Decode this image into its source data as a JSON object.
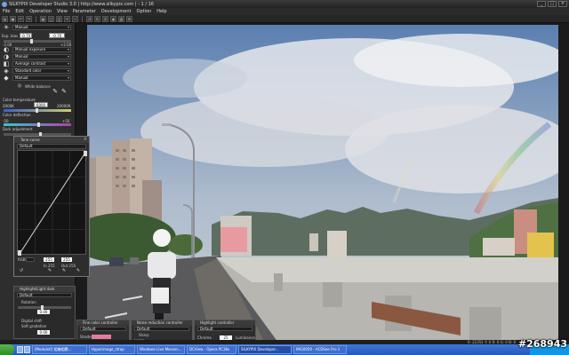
{
  "window": {
    "title": "SILKYPIX Developer Studio 3.0 | http://www.silkypix.com | - 1 / 16"
  },
  "menu": [
    "File",
    "Edit",
    "Operation",
    "View",
    "Parameter",
    "Development",
    "Option",
    "Help"
  ],
  "left_panel": {
    "exposure": {
      "label": "Exp. bias",
      "value": "-0.70",
      "value2": "-0.70"
    },
    "slider_min": "-2.00",
    "slider_max": "+2.00",
    "presets": [
      "Manual",
      "Manual exposure",
      "Manual",
      "Average contrast",
      "Standard color",
      "Manual"
    ],
    "white_balance": "White balance",
    "color_temperature": {
      "label": "Color temperature",
      "min": "2000K",
      "value": "6000",
      "max": "20000K"
    },
    "color_deflection": {
      "label": "Color deflection",
      "min": "-50",
      "max": "+50"
    },
    "dark_adjustment": "Dark adjustment"
  },
  "tone_curve": {
    "title": "Tone curve",
    "preset": "Default",
    "rgb_label": "RGB",
    "in_value": "255",
    "out_value": "255",
    "in_label": "In 255",
    "out_label": "Out 255"
  },
  "highlight_panel": {
    "title": "Highlight/Light dark",
    "preset": "Default",
    "rotation": "Rotation",
    "value": "0.00",
    "digital_shift": "Digital shift",
    "soft_gradation": "Soft gradation",
    "shift_value": "0.00"
  },
  "subpanels": [
    {
      "title": "Fine color controller",
      "preset": "Default",
      "row": "Shade"
    },
    {
      "title": "Noise reduction controller",
      "preset": "Default",
      "row1": "Sharp",
      "row2": "Large"
    },
    {
      "title": "Highlight controller",
      "preset": "Default",
      "row1": "Chroma",
      "value": "25",
      "row2": "Luminance"
    }
  ],
  "status": "X: 22351  Y: 0  R: 0  G: 0  B: 0",
  "taskbar": {
    "items": [
      "[Module0] 相機相關...",
      "Hyperimage_strap",
      "Windows Live Messen...",
      "DCView - Opera PC36s",
      "SILKYPIX Developer...",
      "IMG0959 - ACDSee Pro 1"
    ]
  },
  "watermark": "#268943",
  "colors": {
    "panel": "#2e2e2e",
    "accent": "#3a6fd6"
  }
}
